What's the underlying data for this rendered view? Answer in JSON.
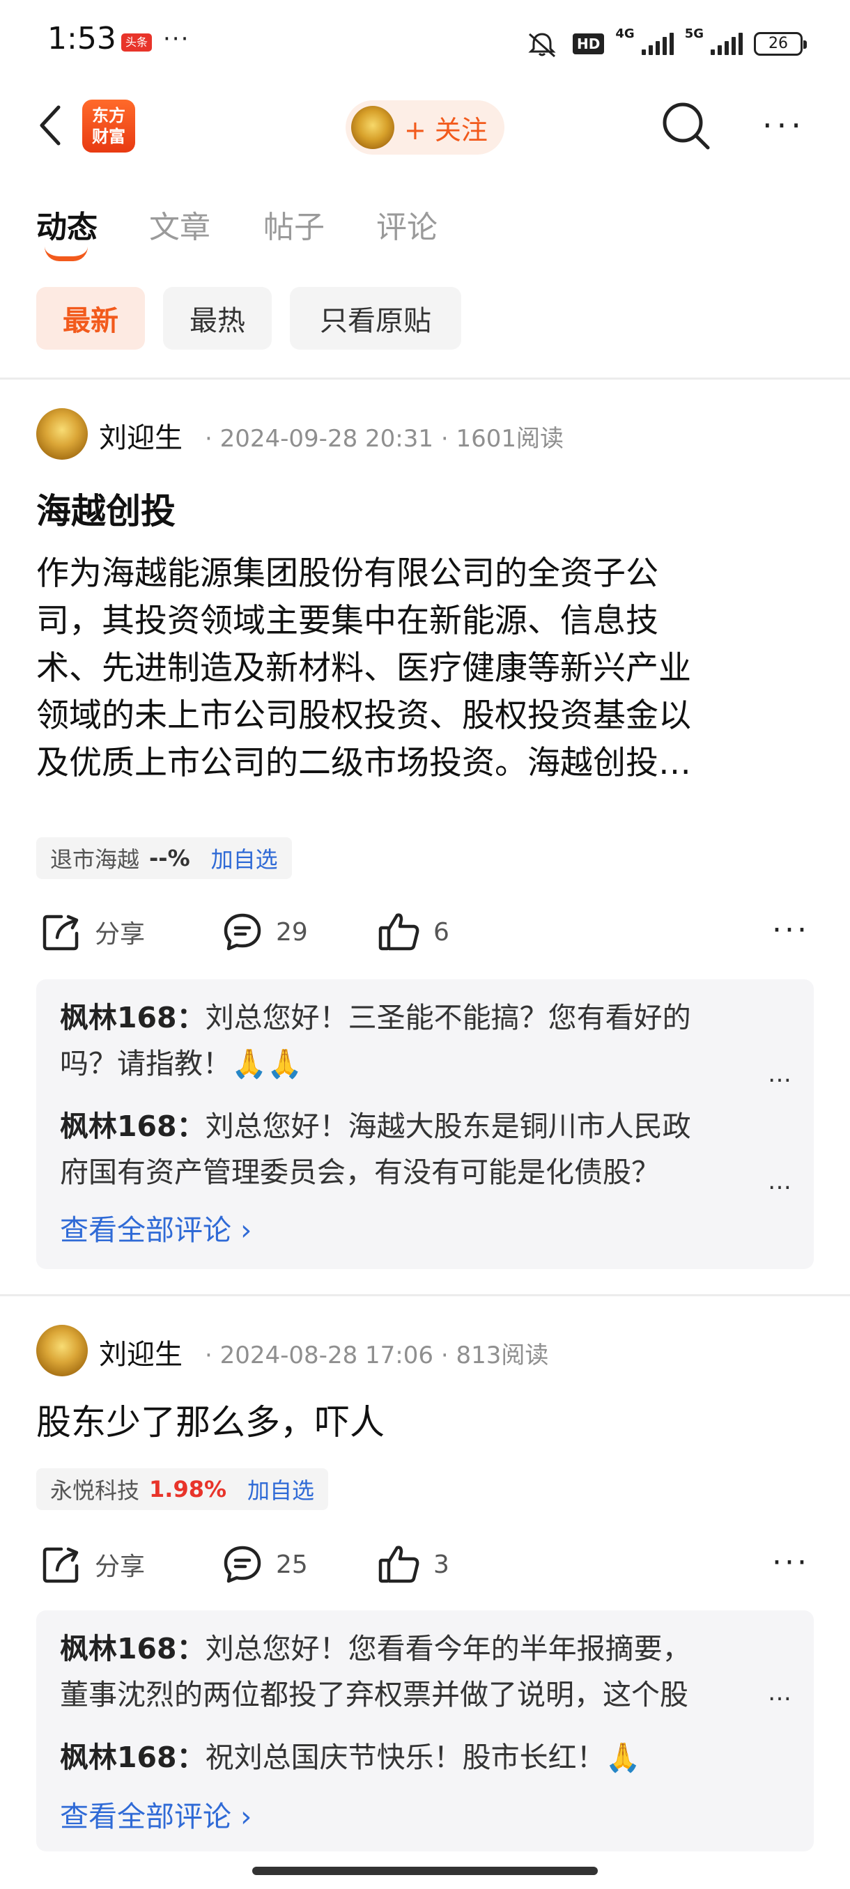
{
  "status": {
    "time": "1:53",
    "app_badge": "头条",
    "dots": "···",
    "hd": "HD",
    "net4g": "4G",
    "net5g": "5G",
    "battery": "26"
  },
  "nav": {
    "logo_line1": "东方",
    "logo_line2": "财富",
    "follow_label": "+ 关注",
    "more": "···"
  },
  "tabs": [
    "动态",
    "文章",
    "帖子",
    "评论"
  ],
  "filters": [
    "最新",
    "最热",
    "只看原贴"
  ],
  "posts": [
    {
      "author": "刘迎生",
      "date": "2024-09-28 20:31",
      "reads": "1601阅读",
      "title": "海越创投",
      "body_lines": [
        "作为海越能源集团股份有限公司的全资子公",
        "司，其投资领域主要集中在新能源、信息技",
        "术、先进制造及新材料、医疗健康等新兴产业",
        "领域的未上市公司股权投资、股权投资基金以",
        "及优质上市公司的二级市场投资。海越创投…"
      ],
      "stock": {
        "name": "退市海越",
        "value": "--%",
        "add": "加自选"
      },
      "share": "分享",
      "comments": "29",
      "likes": "6",
      "comment_items": [
        {
          "user": "枫林168：",
          "lines": [
            "刘总您好！三圣能不能搞？您有看好的",
            "吗？请指教！🙏🙏"
          ]
        },
        {
          "user": "枫林168：",
          "lines": [
            "刘总您好！海越大股东是铜川市人民政",
            "府国有资产管理委员会，有没有可能是化债股？"
          ]
        }
      ],
      "view_all": "查看全部评论 ›"
    },
    {
      "author": "刘迎生",
      "date": "2024-08-28 17:06",
      "reads": "813阅读",
      "body": "股东少了那么多，吓人",
      "stock": {
        "name": "永悦科技",
        "value": "1.98%",
        "add": "加自选"
      },
      "share": "分享",
      "comments": "25",
      "likes": "3",
      "comment_items": [
        {
          "user": "枫林168：",
          "lines": [
            "刘总您好！您看看今年的半年报摘要，",
            "董事沈烈的两位都投了弃权票并做了说明，这个股"
          ]
        },
        {
          "user": "枫林168：",
          "lines": [
            "祝刘总国庆节快乐！股市长红！🙏"
          ]
        }
      ],
      "view_all": "查看全部评论 ›"
    }
  ],
  "colors": {
    "accent": "#f25a1c",
    "link": "#2f6ad6",
    "red": "#e8342a"
  }
}
